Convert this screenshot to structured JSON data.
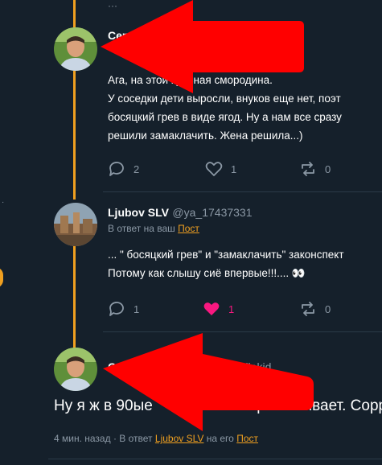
{
  "top_stub": "···",
  "post1": {
    "name": "Сер",
    "body": "Ага, на этой красная смородина.\nУ соседки дети выросли, внуков еще нет, поэт\nбосяцкий грев в виде ягод. Ну а нам все сразу\nрешили замаклачить. Жена решила...)",
    "replies": "2",
    "likes": "1",
    "reposts": "0"
  },
  "post2": {
    "name": "Ljubov SLV",
    "handle": "@ya_17437331",
    "reply_prefix": "В ответ на ваш",
    "reply_link": "Пост",
    "body": "... \" босяцкий грев\" и \"замаклачить\" законспект\nПотому как слышу сиё впервые!!!.... 👀",
    "replies": "1",
    "likes": "1",
    "reposts": "0"
  },
  "post3": {
    "name": "Се",
    "handle": "@mobilekid",
    "body": "Ну я ж в 90ые               от и проскакивает. Сорр",
    "time": "4 мин. назад",
    "reply_prefix": "В ответ",
    "reply_user": "Ljubov SLV",
    "reply_mid": "на его",
    "reply_link": "Пост"
  },
  "colors": {
    "background": "#15202b",
    "accent": "#f0a020",
    "like_active": "#f91880",
    "muted": "#8b98a5",
    "arrow_overlay": "#ff0000"
  },
  "icons": [
    "reply-icon",
    "heart-icon",
    "repost-icon",
    "share-icon"
  ]
}
